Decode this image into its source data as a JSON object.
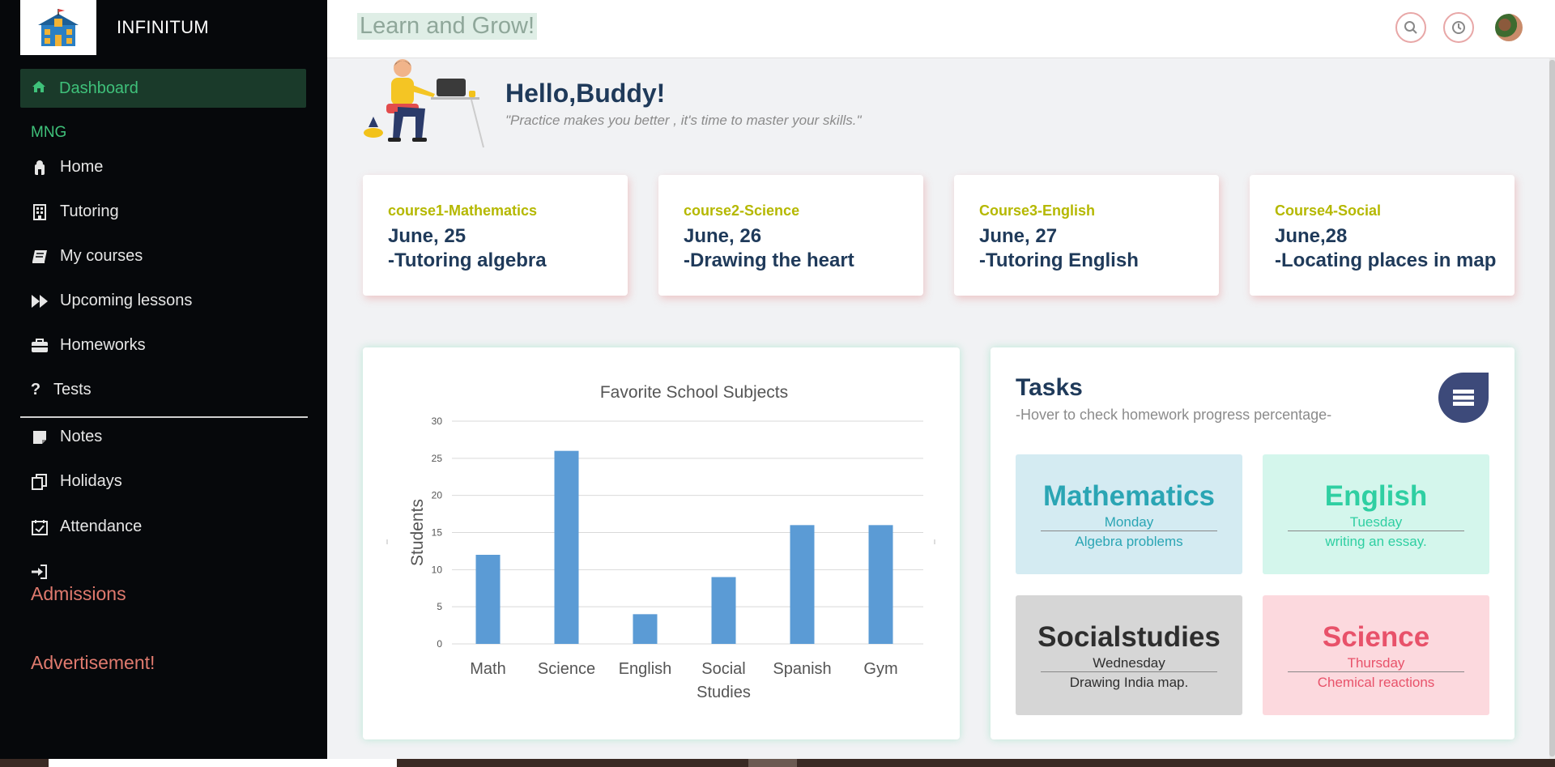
{
  "sidebar": {
    "brand": "INFINITUM",
    "active_item": "Dashboard",
    "section_label": "MNG",
    "items": [
      {
        "label": "Home",
        "icon": "home-icon"
      },
      {
        "label": "Tutoring",
        "icon": "building-icon"
      },
      {
        "label": "My courses",
        "icon": "book-icon"
      },
      {
        "label": "Upcoming lessons",
        "icon": "fast-forward-icon"
      },
      {
        "label": "Homeworks",
        "icon": "briefcase-icon"
      },
      {
        "label": "Tests",
        "icon": "question-icon"
      }
    ],
    "items2": [
      {
        "label": "Notes",
        "icon": "note-icon"
      },
      {
        "label": "Holidays",
        "icon": "copy-icon"
      },
      {
        "label": "Attendance",
        "icon": "calendar-check-icon"
      }
    ],
    "admissions": "Admissions",
    "advertisement": "Advertisement!"
  },
  "header": {
    "title": "Learn and Grow!"
  },
  "hero": {
    "title": "Hello,Buddy!",
    "subtitle": "\"Practice makes you better , it's time to master your skills.\""
  },
  "courses": [
    {
      "title": "course1-Mathematics",
      "date": "June, 25",
      "desc": "-Tutoring algebra"
    },
    {
      "title": "course2-Science",
      "date": "June, 26",
      "desc": "-Drawing the heart"
    },
    {
      "title": "Course3-English",
      "date": "June, 27",
      "desc": "-Tutoring English"
    },
    {
      "title": "Course4-Social",
      "date": "June,28",
      "desc": "-Locating places in map"
    }
  ],
  "chart_data": {
    "type": "bar",
    "title": "Favorite School Subjects",
    "xlabel": "",
    "ylabel": "Students",
    "categories": [
      "Math",
      "Science",
      "English",
      "Social Studies",
      "Spanish",
      "Gym"
    ],
    "values": [
      12,
      26,
      4,
      9,
      16,
      16
    ],
    "ylim": [
      0,
      30
    ],
    "yticks": [
      0,
      5,
      10,
      15,
      20,
      25,
      30
    ],
    "grid": true,
    "bar_color": "#5b9bd5"
  },
  "tasks": {
    "title": "Tasks",
    "subtitle": "-Hover to check homework progress percentage-",
    "items": [
      {
        "name": "Mathematics",
        "day": "Monday",
        "desc": "Algebra problems"
      },
      {
        "name": "English",
        "day": "Tuesday",
        "desc": "writing an essay."
      },
      {
        "name": "Socialstudies",
        "day": "Wednesday",
        "desc": "Drawing India map."
      },
      {
        "name": "Science",
        "day": "Thursday",
        "desc": "Chemical reactions"
      }
    ]
  },
  "colors": {
    "sidebar_bg": "#06080b",
    "accent_green": "#3fc17a",
    "course_title": "#b5b800",
    "navy": "#1f3a5a"
  }
}
